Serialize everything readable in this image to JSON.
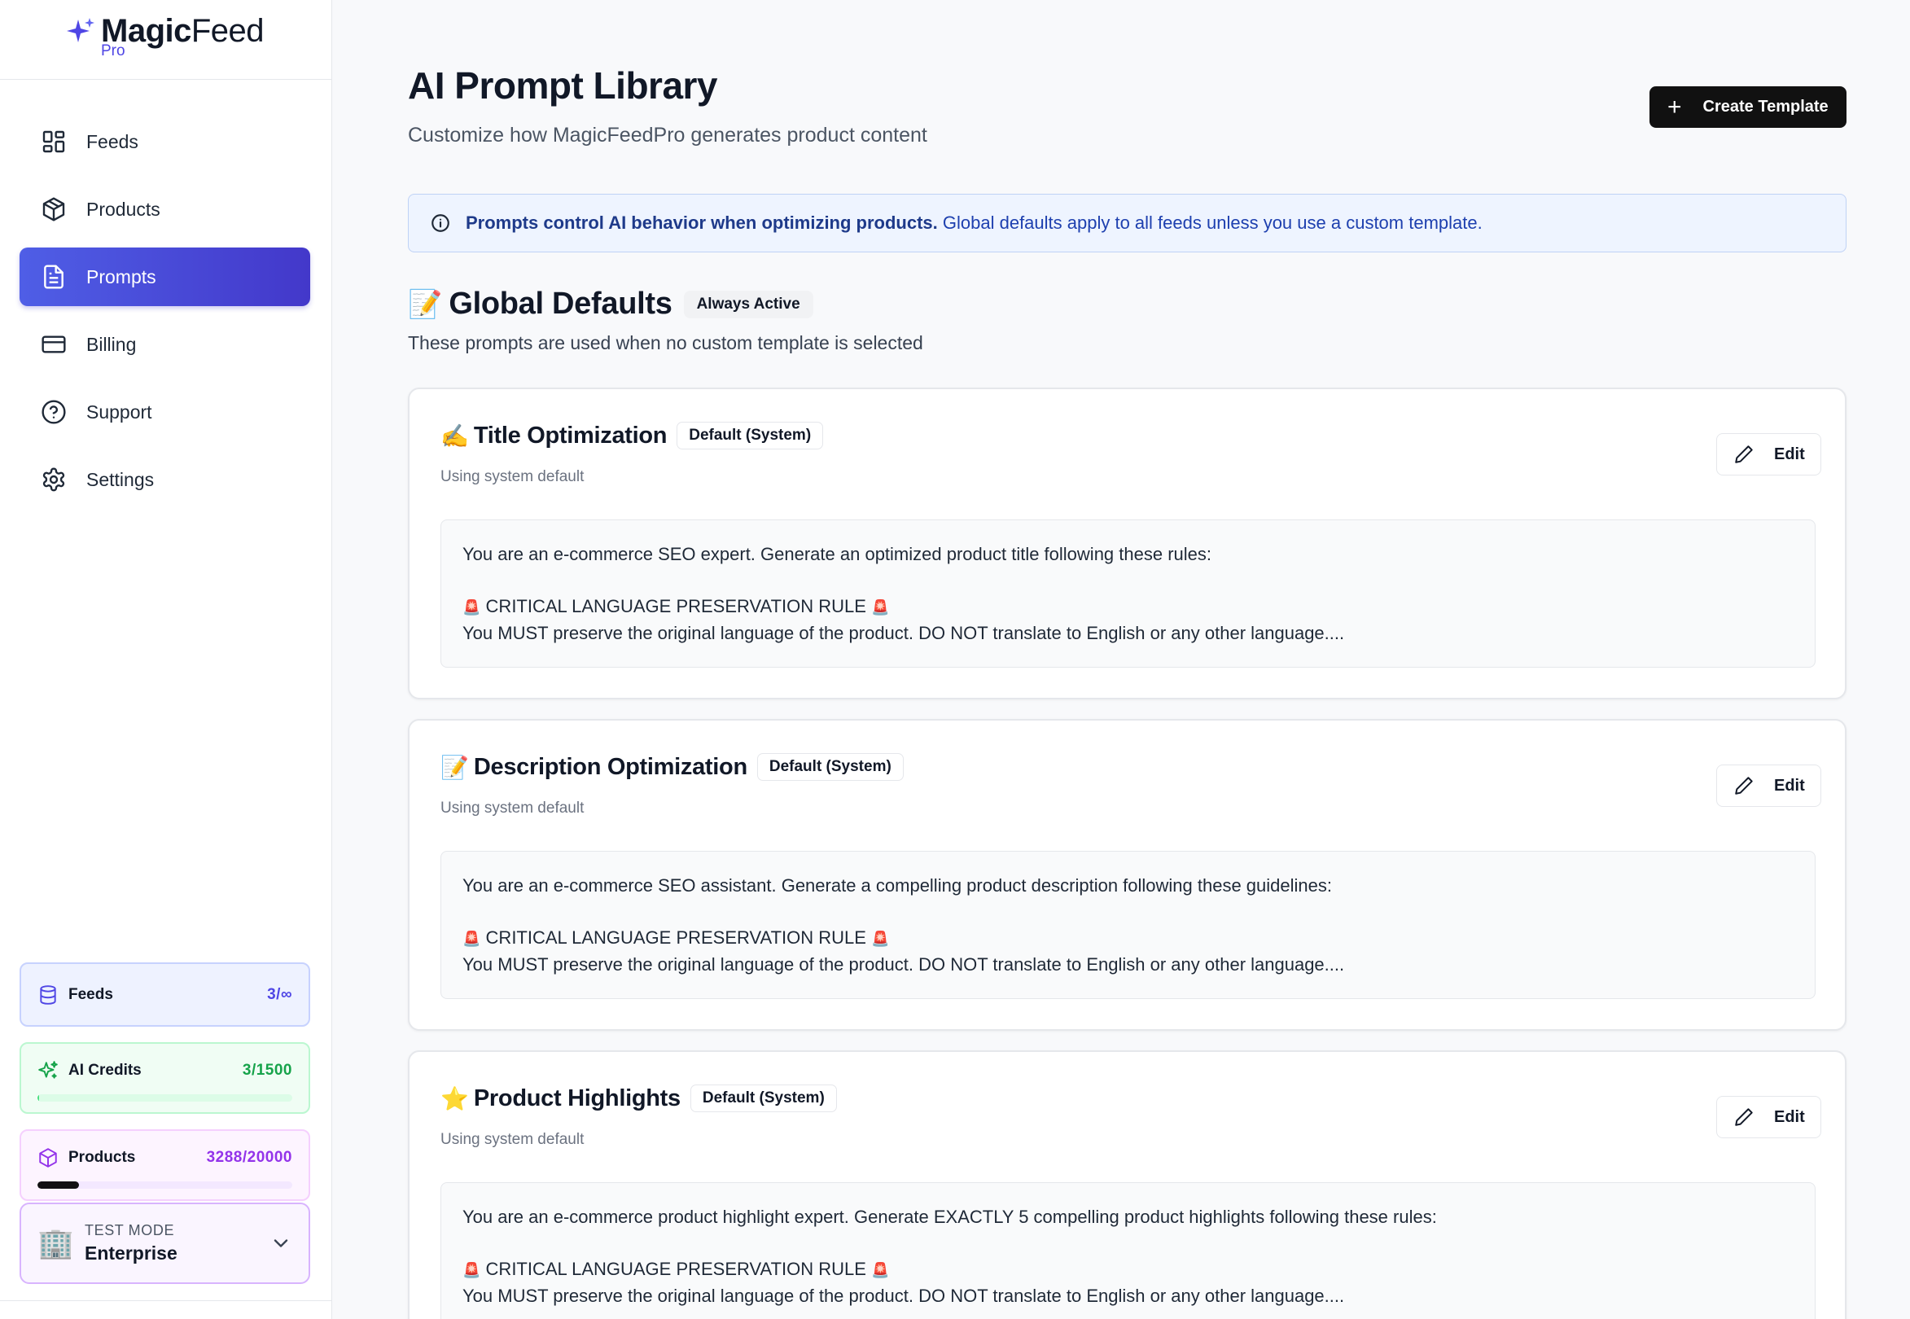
{
  "brand": {
    "name_bold": "Magic",
    "name_regular": "Feed",
    "sub": "Pro"
  },
  "nav": [
    {
      "label": "Feeds",
      "icon": "grid-icon"
    },
    {
      "label": "Products",
      "icon": "box-icon"
    },
    {
      "label": "Prompts",
      "icon": "document-icon",
      "active": true
    },
    {
      "label": "Billing",
      "icon": "credit-card-icon"
    },
    {
      "label": "Support",
      "icon": "help-circle-icon"
    },
    {
      "label": "Settings",
      "icon": "gear-icon"
    }
  ],
  "usage": {
    "feeds": {
      "label": "Feeds",
      "value": "3/∞"
    },
    "ai_credits": {
      "label": "AI Credits",
      "value": "3/1500",
      "fraction": 0.002
    },
    "products": {
      "label": "Products",
      "value": "3288/20000",
      "fraction": 0.1644
    }
  },
  "mode": {
    "label": "TEST MODE",
    "plan": "Enterprise",
    "icon": "🏢"
  },
  "header": {
    "title": "AI Prompt Library",
    "subtitle": "Customize how MagicFeedPro generates product content",
    "create_label": "Create Template"
  },
  "info": {
    "bold": "Prompts control AI behavior when optimizing products.",
    "text": " Global defaults apply to all feeds unless you use a custom template."
  },
  "section": {
    "emoji": "📝",
    "title": "Global Defaults",
    "badge": "Always Active",
    "subtitle": "These prompts are used when no custom template is selected"
  },
  "cards": [
    {
      "emoji": "✍️",
      "title": "Title Optimization",
      "badge": "Default (System)",
      "status": "Using system default",
      "edit_label": "Edit",
      "line1": "You are an e-commerce SEO expert. Generate an optimized product title following these rules:",
      "rule": "CRITICAL LANGUAGE PRESERVATION RULE",
      "line3": "You MUST preserve the original language of the product. DO NOT translate to English or any other language...."
    },
    {
      "emoji": "📝",
      "title": "Description Optimization",
      "badge": "Default (System)",
      "status": "Using system default",
      "edit_label": "Edit",
      "line1": "You are an e-commerce SEO assistant. Generate a compelling product description following these guidelines:",
      "rule": "CRITICAL LANGUAGE PRESERVATION RULE",
      "line3": "You MUST preserve the original language of the product. DO NOT translate to English or any other language...."
    },
    {
      "emoji": "⭐",
      "title": "Product Highlights",
      "badge": "Default (System)",
      "status": "Using system default",
      "edit_label": "Edit",
      "line1": "You are an e-commerce product highlight expert. Generate EXACTLY 5 compelling product highlights following these rules:",
      "rule": "CRITICAL LANGUAGE PRESERVATION RULE",
      "line3": "You MUST preserve the original language of the product. DO NOT translate to English or any other language...."
    }
  ]
}
